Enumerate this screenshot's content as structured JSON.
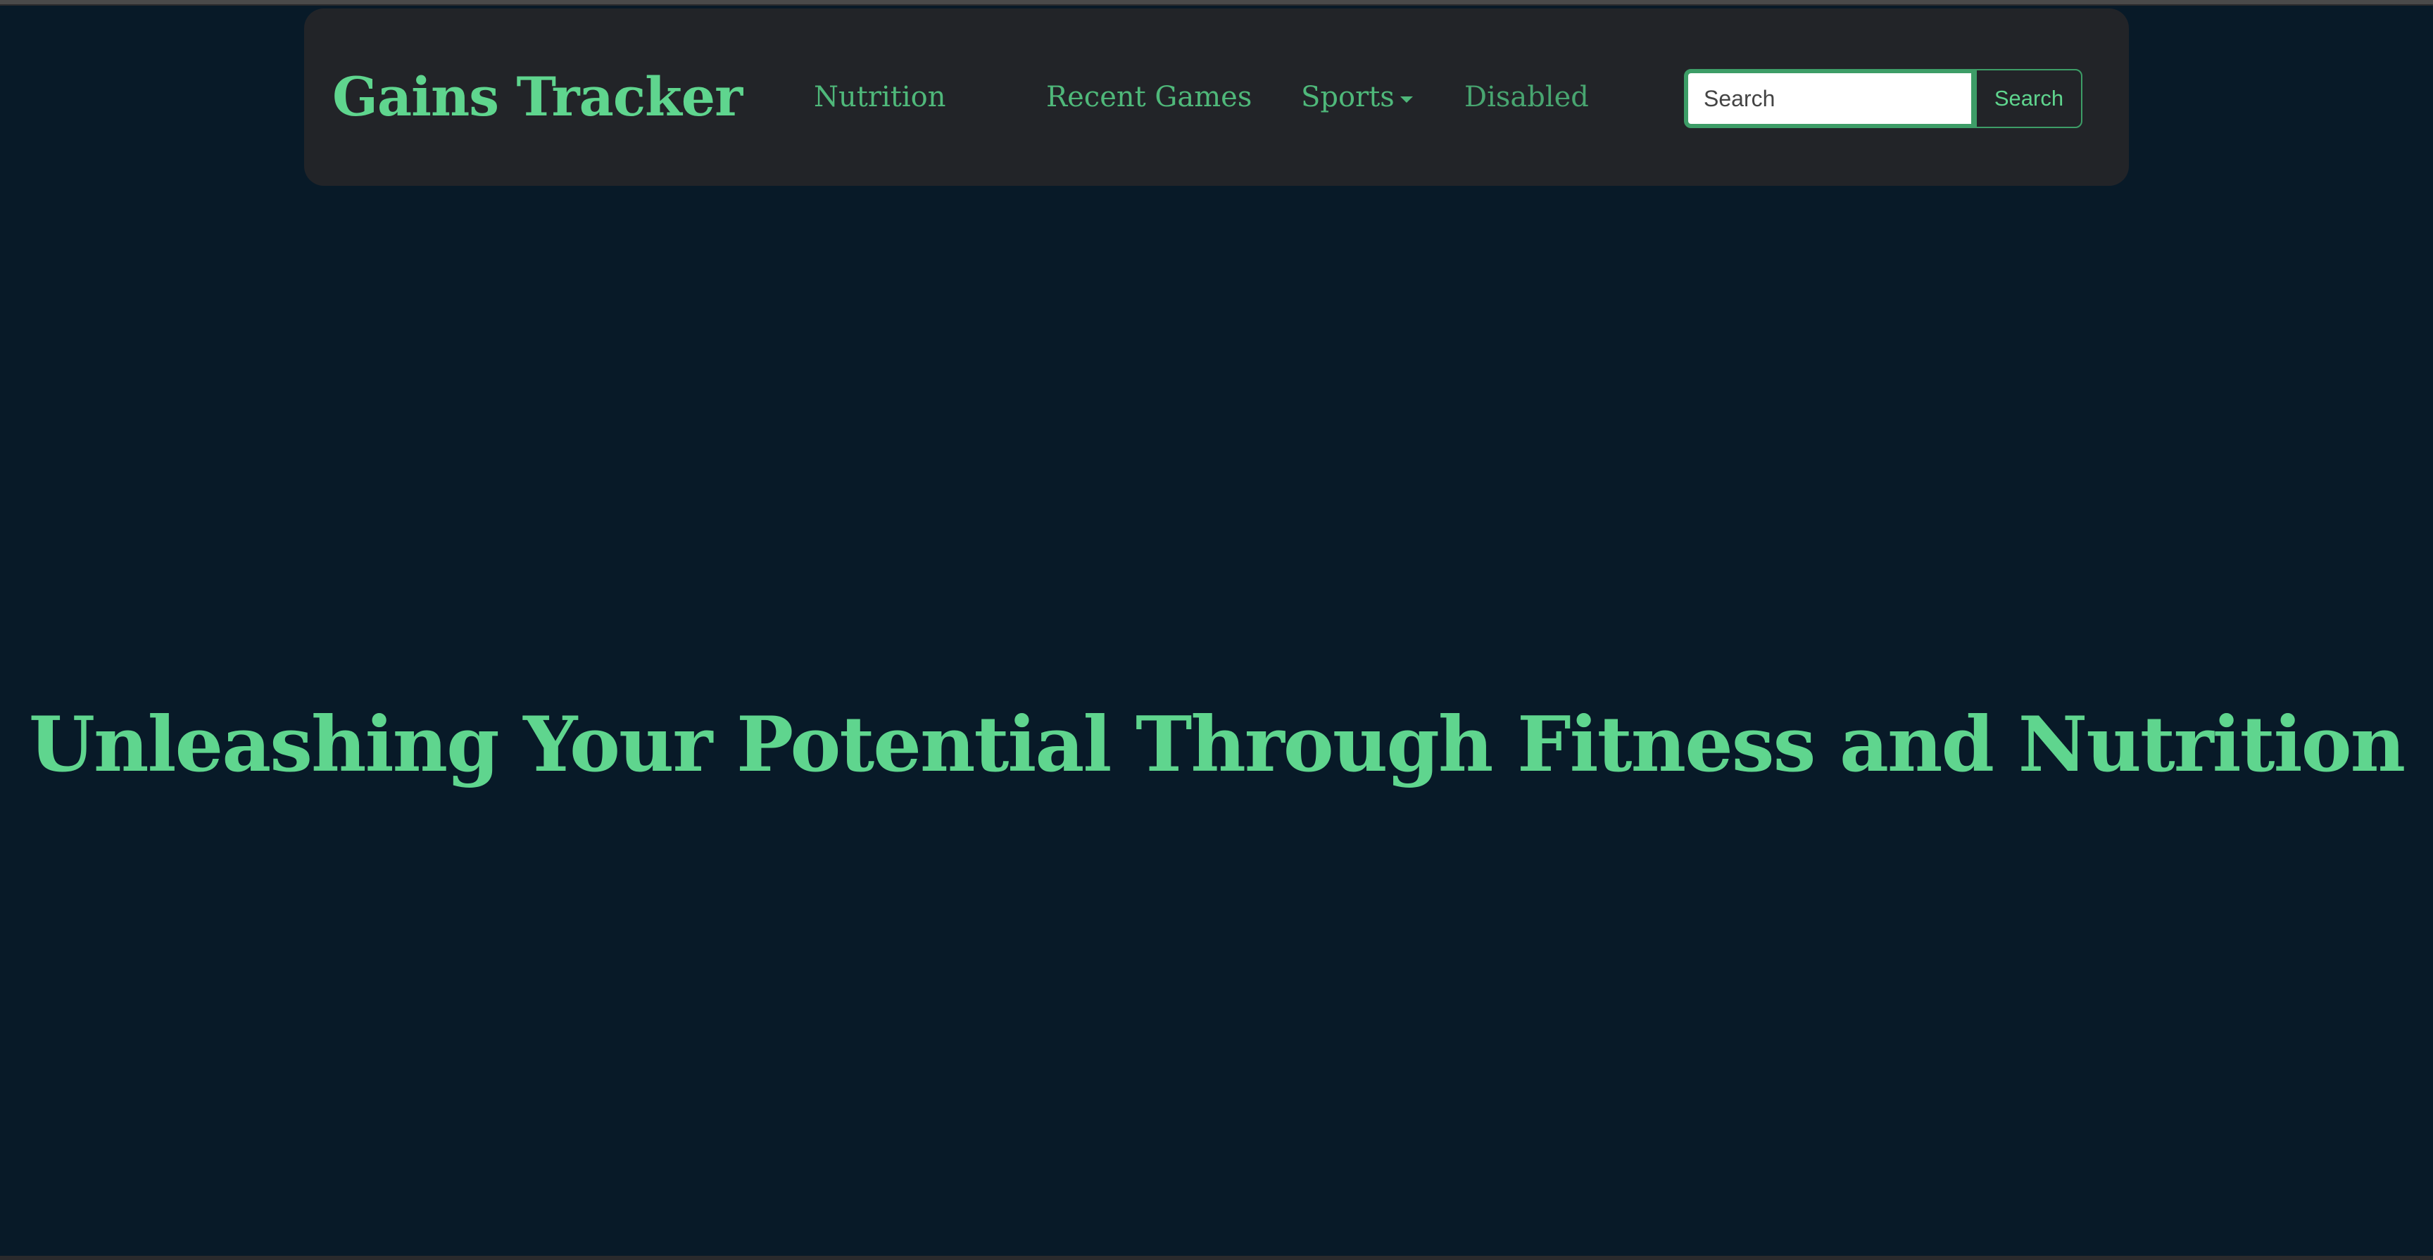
{
  "navbar": {
    "brand": "Gains Tracker",
    "links": [
      {
        "label": "Nutrition"
      },
      {
        "label": "Recent Games"
      },
      {
        "label": "Sports"
      },
      {
        "label": "Disabled"
      }
    ],
    "search": {
      "placeholder": "Search",
      "button_label": "Search"
    }
  },
  "hero": {
    "title": "Unleashing Your Potential Through Fitness and Nutrition"
  },
  "colors": {
    "background": "#081a28",
    "navbar": "#222428",
    "accent": "#5fd58e",
    "link": "#4fb87a",
    "input_border": "#3d9d67"
  },
  "icons": {
    "sports_dropdown": "chevron-down-icon"
  }
}
